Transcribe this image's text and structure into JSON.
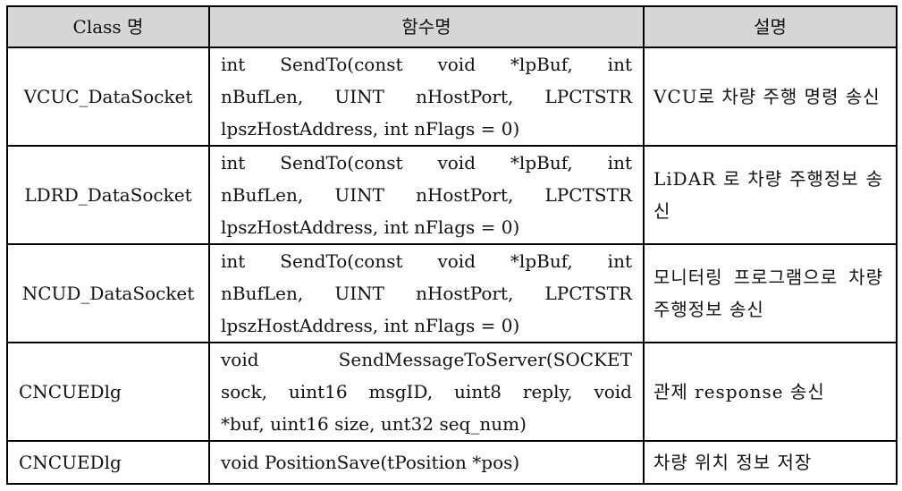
{
  "table": {
    "headers": [
      "Class 명",
      "함수명",
      "설명"
    ],
    "rows": [
      {
        "class_name": "VCUC_DataSocket",
        "function_lines": [
          "int SendTo(const void *lpBuf, int",
          "nBufLen, UINT nHostPort, LPCTSTR",
          "lpszHostAddress, int nFlags = 0)"
        ],
        "description": "VCU로 차량 주행 명령 송신"
      },
      {
        "class_name": "LDRD_DataSocket",
        "function_lines": [
          "int SendTo(const void *lpBuf, int",
          "nBufLen, UINT nHostPort, LPCTSTR",
          "lpszHostAddress, int nFlags = 0)"
        ],
        "description": "LiDAR 로 차량 주행정보 송신"
      },
      {
        "class_name": "NCUD_DataSocket",
        "function_lines": [
          "int SendTo(const void *lpBuf, int",
          "nBufLen, UINT nHostPort, LPCTSTR",
          "lpszHostAddress, int nFlags = 0)"
        ],
        "description": "모니터링 프로그램으로 차량주행정보 송신"
      },
      {
        "class_name": "CNCUEDlg",
        "function_lines": [
          "void SendMessageToServer(SOCKET",
          "sock, uint16 msgID, uint8 reply, void",
          "*buf, uint16 size, unt32 seq_num)"
        ],
        "description": "관제 response 송신"
      },
      {
        "class_name": "CNCUEDlg",
        "function_lines": [
          "void PositionSave(tPosition *pos)"
        ],
        "description": "차량 위치 정보 저장"
      }
    ]
  }
}
